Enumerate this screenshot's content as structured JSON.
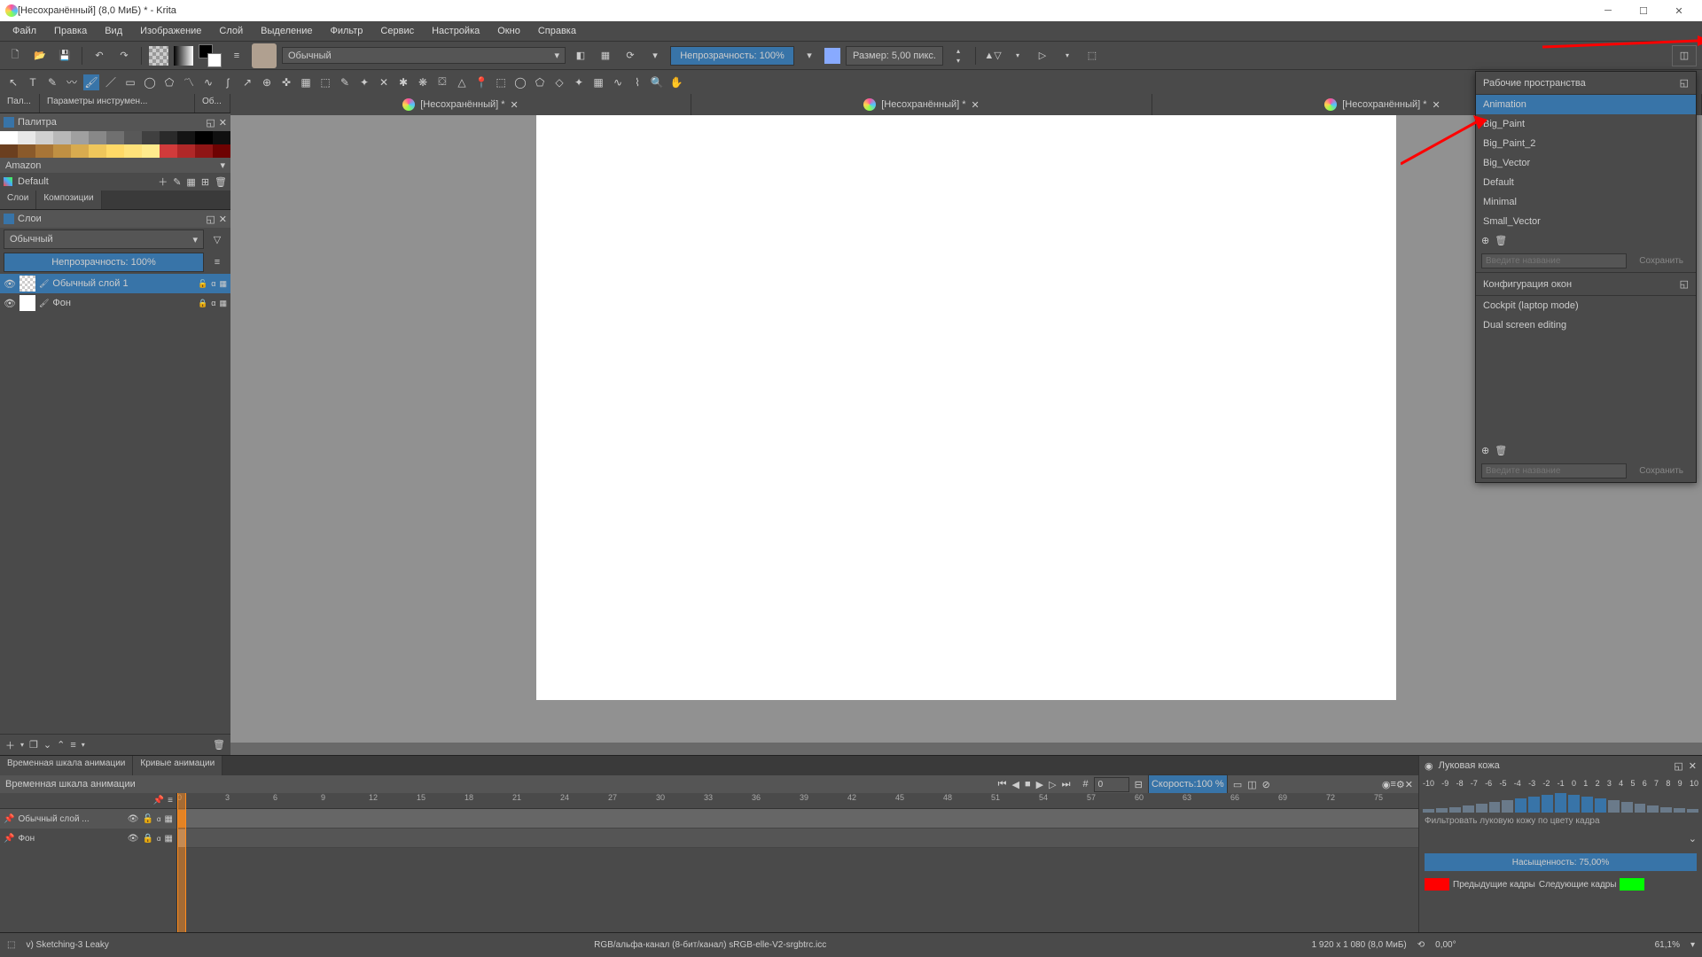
{
  "title": "[Несохранённый]  (8,0 МиБ)  * - Krita",
  "menu": [
    "Файл",
    "Правка",
    "Вид",
    "Изображение",
    "Слой",
    "Выделение",
    "Фильтр",
    "Сервис",
    "Настройка",
    "Окно",
    "Справка"
  ],
  "toolbar": {
    "blend_mode": "Обычный",
    "opacity_label": "Непрозрачность: 100%",
    "size_label": "Размер: 5,00 пикс."
  },
  "left": {
    "tabs": [
      "Пал...",
      "Параметры инструмен...",
      "Об..."
    ],
    "palette_title": "Палитра",
    "palette_name": "Amazon",
    "palette_default": "Default",
    "swatch_colors": [
      "#ffffff",
      "#e8e8e8",
      "#d0d0d0",
      "#b8b8b8",
      "#a0a0a0",
      "#888888",
      "#707070",
      "#585858",
      "#404040",
      "#2a2a2a",
      "#141414",
      "#000000",
      "#101010",
      "#6b3f1f",
      "#8a5a2b",
      "#a87537",
      "#c09043",
      "#d8ab4f",
      "#efc65b",
      "#ffd967",
      "#ffe27a",
      "#ffeb8d",
      "#d13b3b",
      "#b02828",
      "#8f1515",
      "#6e0202"
    ],
    "layers_tab": "Слои",
    "comps_tab": "Композиции",
    "layers_title": "Слои",
    "layer_blend": "Обычный",
    "layer_opacity": "Непрозрачность:  100%",
    "layer1": "Обычный слой 1",
    "layer2": "Фон"
  },
  "doc_tabs": [
    "[Несохранённый] *",
    "[Несохранённый] *",
    "[Несохранённый] *",
    ""
  ],
  "workspace": {
    "title": "Рабочие пространства",
    "items": [
      "Animation",
      "Big_Paint",
      "Big_Paint_2",
      "Big_Vector",
      "Default",
      "Minimal",
      "Small_Vector"
    ],
    "selected": "Animation",
    "input_placeholder": "Введите название",
    "save_label": "Сохранить",
    "win_title": "Конфигурация окон",
    "win_items": [
      "Cockpit (laptop mode)",
      "Dual screen editing"
    ]
  },
  "anim": {
    "tabs": [
      "Временная шкала анимации",
      "Кривые анимации"
    ],
    "title": "Временная шкала анимации",
    "frame_input": "0",
    "speed_label": "Скорость:100 %",
    "ticks": [
      0,
      3,
      6,
      9,
      12,
      15,
      18,
      21,
      24,
      27,
      30,
      33,
      36,
      39,
      42,
      45,
      48,
      51,
      54,
      57,
      60,
      63,
      66,
      69,
      72,
      75
    ],
    "layer1": "Обычный слой ...",
    "layer2": "Фон",
    "onion_title": "Луковая кожа",
    "onion_ticks": [
      "-10",
      "-9",
      "-8",
      "-7",
      "-6",
      "-5",
      "-4",
      "-3",
      "-2",
      "-1",
      "0",
      "1",
      "2",
      "3",
      "4",
      "5",
      "6",
      "7",
      "8",
      "9",
      "10"
    ],
    "onion_filter": "Фильтровать луковую кожу по цвету кадра",
    "onion_sat": "Насыщенность: 75,00%",
    "prev_label": "Предыдущие кадры",
    "next_label": "Следующие кадры"
  },
  "status": {
    "brush": "v) Sketching-3 Leaky",
    "color_info": "RGB/альфа-канал (8-бит/канал)  sRGB-elle-V2-srgbtrc.icc",
    "dims": "1 920 x 1 080 (8,0 МиБ)",
    "angle": "0,00°",
    "zoom": "61,1%"
  }
}
